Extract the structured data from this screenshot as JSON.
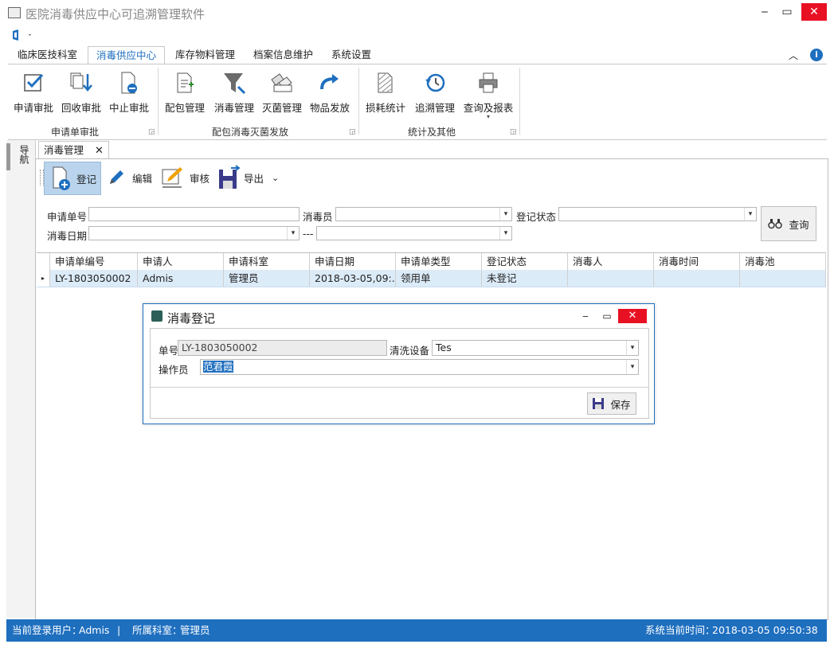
{
  "window": {
    "title": "医院消毒供应中心可追溯管理软件",
    "minimize": "‒",
    "maximize": "▭",
    "close": "✕"
  },
  "ribbon": {
    "tabs": [
      "临床医技科室",
      "消毒供应中心",
      "库存物料管理",
      "档案信息维护",
      "系统设置"
    ],
    "active_tab": "消毒供应中心",
    "groups": [
      {
        "label": "申请单审批",
        "buttons": [
          "申请审批",
          "回收审批",
          "中止审批"
        ]
      },
      {
        "label": "配包消毒灭菌发放",
        "buttons": [
          "配包管理",
          "消毒管理",
          "灭菌管理",
          "物品发放"
        ]
      },
      {
        "label": "统计及其他",
        "buttons": [
          "损耗统计",
          "追溯管理",
          "查询及报表"
        ]
      }
    ]
  },
  "side_panel": {
    "nav_label": "导航"
  },
  "doc_tab": {
    "label": "消毒管理",
    "close": "✕"
  },
  "toolbar": {
    "register": "登记",
    "edit": "编辑",
    "audit": "审核",
    "export": "导出"
  },
  "search": {
    "order_no_label": "申请单号",
    "order_no_value": "",
    "disinfector_label": "消毒员",
    "disinfector_value": "",
    "reg_status_label": "登记状态",
    "reg_status_value": "",
    "date_label": "消毒日期",
    "date_from": "",
    "date_sep": "---",
    "date_to": "",
    "query_button": "查询"
  },
  "grid": {
    "columns": [
      "申请单编号",
      "申请人",
      "申请科室",
      "申请日期",
      "申请单类型",
      "登记状态",
      "消毒人",
      "消毒时间",
      "消毒池"
    ],
    "rows": [
      [
        "LY-1803050002",
        "Admis",
        "管理员",
        "2018-03-05,09:...",
        "领用单",
        "未登记",
        "",
        "",
        ""
      ]
    ]
  },
  "dialog": {
    "title": "消毒登记",
    "order_label": "单号",
    "order_value": "LY-1803050002",
    "device_label": "清洗设备",
    "device_value": "Tes",
    "operator_label": "操作员",
    "operator_value": "范君霞",
    "save": "保存"
  },
  "status_bar": {
    "user_label": "当前登录用户：",
    "user": "Admis",
    "dept_label": "所属科室：",
    "dept": "管理员",
    "time_label": "系统当前时间：",
    "time": "2018-03-05 09:50:38"
  },
  "colors": {
    "accent": "#1f6fbf",
    "close_red": "#e81123",
    "row_selected": "#dcebf8"
  }
}
